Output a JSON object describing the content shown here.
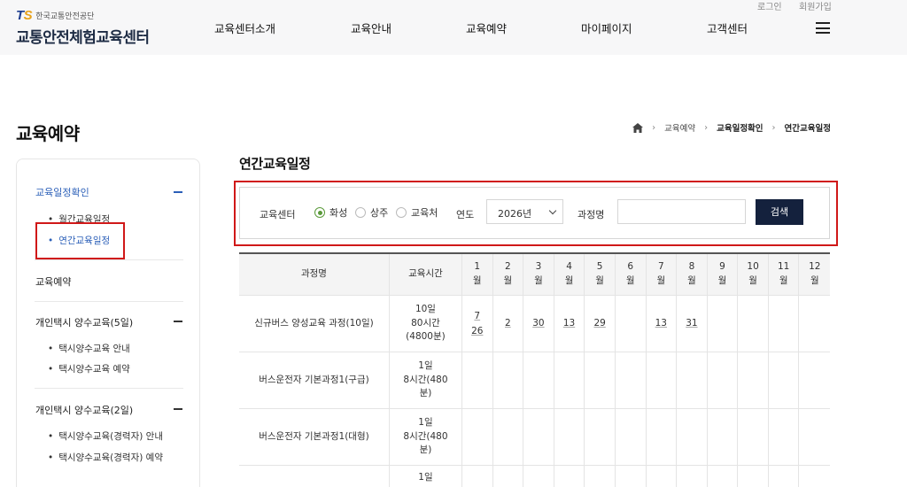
{
  "header": {
    "logo_ts": "TS",
    "logo_sub": "한국교통안전공단",
    "logo_main": "교통안전체험교육센터",
    "nav": [
      "교육센터소개",
      "교육안내",
      "교육예약",
      "마이페이지",
      "고객센터"
    ],
    "login": "로그인",
    "signup": "회원가입"
  },
  "page_title": "교육예약",
  "breadcrumb": [
    "교육예약",
    "교육일정확인",
    "연간교육일정"
  ],
  "sidebar": {
    "group1": {
      "label": "교육일정확인",
      "items": [
        "월간교육일정",
        "연간교육일정"
      ]
    },
    "group2": {
      "label": "교육예약"
    },
    "group3": {
      "label": "개인택시 양수교육(5일)",
      "items": [
        "택시양수교육 안내",
        "택시양수교육 예약"
      ]
    },
    "group4": {
      "label": "개인택시 양수교육(2일)",
      "items": [
        "택시양수교육(경력자) 안내",
        "택시양수교육(경력자) 예약"
      ]
    }
  },
  "section_title": "연간교육일정",
  "search": {
    "center_label": "교육센터",
    "options": [
      "화성",
      "상주",
      "교육처"
    ],
    "selected_option": "화성",
    "year_label": "연도",
    "year_value": "2026년",
    "course_label": "과정명",
    "course_value": "",
    "button": "검색"
  },
  "table": {
    "col_name": "과정명",
    "col_time": "교육시간",
    "months": [
      [
        "1",
        "월"
      ],
      [
        "2",
        "월"
      ],
      [
        "3",
        "월"
      ],
      [
        "4",
        "월"
      ],
      [
        "5",
        "월"
      ],
      [
        "6",
        "월"
      ],
      [
        "7",
        "월"
      ],
      [
        "8",
        "월"
      ],
      [
        "9",
        "월"
      ],
      [
        "10",
        "월"
      ],
      [
        "11",
        "월"
      ],
      [
        "12",
        "월"
      ]
    ],
    "rows": [
      {
        "name": "신규버스 양성교육 과정(10일)",
        "time": [
          "10일",
          "80시간",
          "(4800분)"
        ],
        "days": [
          [
            "7",
            "26"
          ],
          [
            "2"
          ],
          [
            "30"
          ],
          [
            "13"
          ],
          [
            "29"
          ],
          [],
          [
            "13"
          ],
          [
            "31"
          ],
          [],
          [],
          [],
          []
        ]
      },
      {
        "name": "버스운전자 기본과정1(구급)",
        "time": [
          "1일",
          "8시간(480",
          "분)"
        ],
        "days": [
          [],
          [],
          [],
          [],
          [],
          [],
          [],
          [],
          [],
          [],
          [],
          []
        ]
      },
      {
        "name": "버스운전자 기본과정1(대형)",
        "time": [
          "1일",
          "8시간(480",
          "분)"
        ],
        "days": [
          [],
          [],
          [],
          [],
          [],
          [],
          [],
          [],
          [],
          [],
          [],
          []
        ]
      },
      {
        "name": "",
        "time": [
          "1일"
        ],
        "days": [
          [],
          [],
          [],
          [],
          [],
          [],
          [],
          [],
          [],
          [],
          [],
          []
        ]
      }
    ]
  },
  "colors": {
    "accent_blue": "#2b5fb8",
    "button_navy": "#14213d",
    "highlight_red": "#d01818",
    "radio_green": "#5a9a3a"
  }
}
